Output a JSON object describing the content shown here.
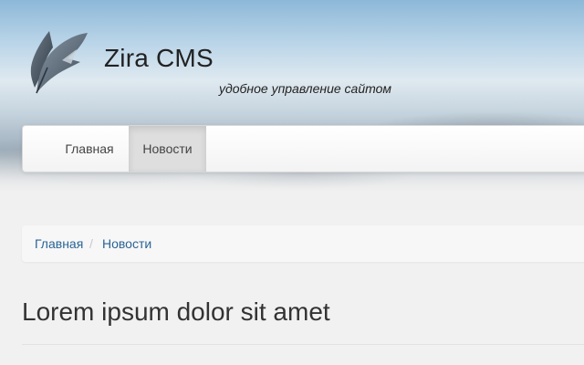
{
  "header": {
    "site_title": "Zira CMS",
    "slogan": "удобное управление сайтом",
    "logo_icon": "feather-logo-icon"
  },
  "nav": {
    "items": [
      {
        "label": "Главная",
        "active": false
      },
      {
        "label": "Новости",
        "active": true
      }
    ]
  },
  "breadcrumb": {
    "items": [
      "Главная",
      "Новости"
    ],
    "separator": "/"
  },
  "main": {
    "title": "Lorem ipsum dolor sit amet"
  },
  "colors": {
    "link": "#2a6496",
    "active_nav_bg": "#dedede"
  }
}
